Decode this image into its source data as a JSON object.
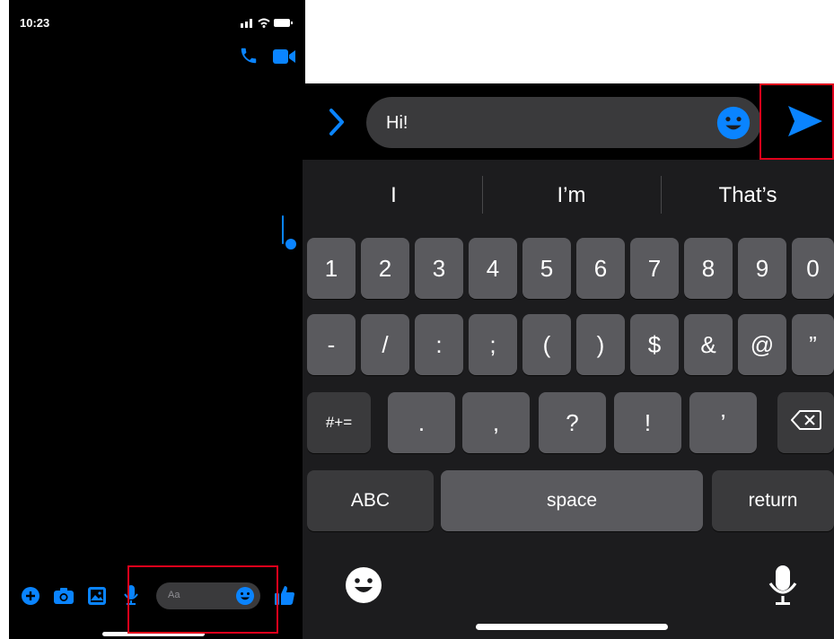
{
  "status": {
    "time": "10:23"
  },
  "left_compose": {
    "placeholder": "Aa"
  },
  "right_compose": {
    "message": "Hi!"
  },
  "suggestions": [
    "I",
    "I’m",
    "That’s"
  ],
  "row1": [
    "1",
    "2",
    "3",
    "4",
    "5",
    "6",
    "7",
    "8",
    "9",
    "0"
  ],
  "row2": [
    "-",
    "/",
    ":",
    ";",
    "(",
    ")",
    "$",
    "&",
    "@",
    "”"
  ],
  "row3": {
    "mode": "#+=",
    "keys": [
      ".",
      ",",
      "?",
      "!",
      "’"
    ]
  },
  "row4": {
    "abc": "ABC",
    "space": "space",
    "return": "return"
  },
  "colors": {
    "accent": "#0a84ff",
    "highlight": "#e0001b"
  },
  "icons": [
    "phone-icon",
    "video-icon",
    "plus-icon",
    "camera-icon",
    "gallery-icon",
    "mic-icon",
    "emoji-icon",
    "like-icon",
    "chevron-right-icon",
    "send-icon",
    "backspace-icon",
    "emoji-keyboard-icon",
    "dictation-icon"
  ]
}
